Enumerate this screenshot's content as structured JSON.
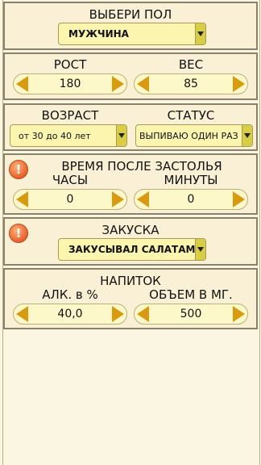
{
  "gender": {
    "title": "ВЫБЕРИ ПОЛ",
    "selected": "МУЖЧИНА"
  },
  "body": {
    "height_label": "РОСТ",
    "height_value": "180",
    "weight_label": "ВЕС",
    "weight_value": "85"
  },
  "age_status": {
    "age_label": "ВОЗРАСТ",
    "age_selected": "от 30 до 40 лет",
    "status_label": "СТАТУС",
    "status_selected": "ВЫПИВАЮ ОДИН РАЗ В"
  },
  "time": {
    "title": "ВРЕМЯ ПОСЛЕ ЗАСТОЛЬЯ",
    "hours_label": "ЧАСЫ",
    "hours_value": "0",
    "minutes_label": "МИНУТЫ",
    "minutes_value": "0",
    "warning_icon": "!"
  },
  "snack": {
    "title": "ЗАКУСКА",
    "selected": "ЗАКУСЫВАЛ САЛАТАМИ",
    "warning_icon": "!"
  },
  "drink": {
    "title": "НАПИТОК",
    "alc_label": "АЛК. в %",
    "alc_value": "40,0",
    "volume_label": "ОБЪЕМ В МГ.",
    "volume_value": "500"
  },
  "colors": {
    "background": "#fbf6e2",
    "panel": "#f9f0d5",
    "arrow": "#d99a10",
    "warning": "#e8602a",
    "select": "#fbf5b0"
  }
}
